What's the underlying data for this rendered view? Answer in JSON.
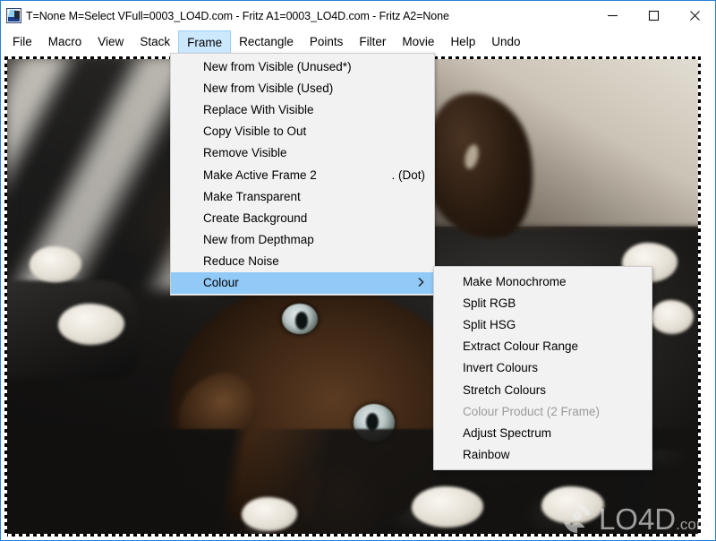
{
  "window": {
    "title": "T=None M=Select VFull=0003_LO4D.com - Fritz A1=0003_LO4D.com - Fritz A2=None",
    "icon_name": "fritz-app-icon",
    "accent_color": "#2a7fd4",
    "controls": {
      "minimize_label": "Minimize",
      "maximize_label": "Maximize",
      "close_label": "Close"
    }
  },
  "menubar": {
    "items": [
      {
        "label": "File",
        "active": false
      },
      {
        "label": "Macro",
        "active": false
      },
      {
        "label": "View",
        "active": false
      },
      {
        "label": "Stack",
        "active": false
      },
      {
        "label": "Frame",
        "active": true
      },
      {
        "label": "Rectangle",
        "active": false
      },
      {
        "label": "Points",
        "active": false
      },
      {
        "label": "Filter",
        "active": false
      },
      {
        "label": "Movie",
        "active": false
      },
      {
        "label": "Help",
        "active": false
      },
      {
        "label": "Undo",
        "active": false
      }
    ],
    "highlight_color": "#cce8ff"
  },
  "frame_menu": {
    "owner": "Frame",
    "highlight_color": "#91c9f7",
    "items": [
      {
        "label": "New from Visible (Unused*)",
        "accel": "",
        "highlight": false,
        "disabled": false,
        "submenu": false
      },
      {
        "label": "New from Visible (Used)",
        "accel": "",
        "highlight": false,
        "disabled": false,
        "submenu": false
      },
      {
        "label": "Replace With Visible",
        "accel": "",
        "highlight": false,
        "disabled": false,
        "submenu": false
      },
      {
        "label": "Copy Visible to Out",
        "accel": "",
        "highlight": false,
        "disabled": false,
        "submenu": false
      },
      {
        "label": "Remove Visible",
        "accel": "",
        "highlight": false,
        "disabled": false,
        "submenu": false
      },
      {
        "label": "Make Active Frame 2",
        "accel": ". (Dot)",
        "highlight": false,
        "disabled": false,
        "submenu": false
      },
      {
        "label": "Make Transparent",
        "accel": "",
        "highlight": false,
        "disabled": false,
        "submenu": false
      },
      {
        "label": "Create Background",
        "accel": "",
        "highlight": false,
        "disabled": false,
        "submenu": false
      },
      {
        "label": "New from Depthmap",
        "accel": "",
        "highlight": false,
        "disabled": false,
        "submenu": false
      },
      {
        "label": "Reduce Noise",
        "accel": "",
        "highlight": false,
        "disabled": false,
        "submenu": false
      },
      {
        "label": "Colour",
        "accel": "",
        "highlight": true,
        "disabled": false,
        "submenu": true
      }
    ]
  },
  "colour_submenu": {
    "owner": "Colour",
    "items": [
      {
        "label": "Make Monochrome",
        "disabled": false
      },
      {
        "label": "Split RGB",
        "disabled": false
      },
      {
        "label": "Split HSG",
        "disabled": false
      },
      {
        "label": "Extract Colour Range",
        "disabled": false
      },
      {
        "label": "Invert Colours",
        "disabled": false
      },
      {
        "label": "Stretch Colours",
        "disabled": false
      },
      {
        "label": "Colour Product (2 Frame)",
        "disabled": true
      },
      {
        "label": "Adjust Spectrum",
        "disabled": false
      },
      {
        "label": "Rainbow",
        "disabled": false
      }
    ]
  },
  "canvas": {
    "selection": "marching-ants-border",
    "image_description": "photo of a dark cat lying on a black and white striped blanket"
  },
  "watermark": {
    "text": "LO4D",
    "suffix": ".com",
    "logo_name": "lo4d-logo"
  }
}
